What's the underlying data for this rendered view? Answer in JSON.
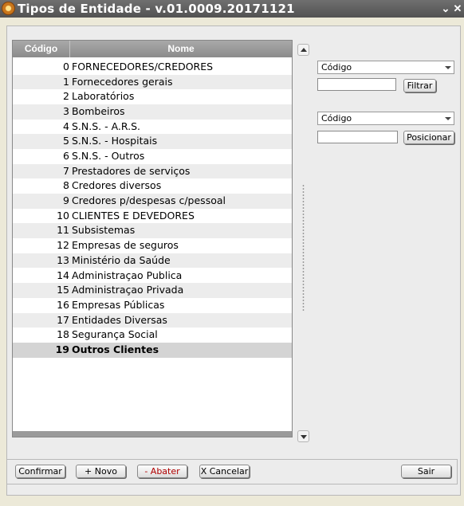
{
  "window": {
    "title": "Tipos de Entidade - v.01.0009.20171121",
    "minimize_glyph": "⌄",
    "close_glyph": "✕"
  },
  "grid": {
    "columns": {
      "code": "Código",
      "name": "Nome"
    },
    "rows": [
      {
        "code": "0",
        "name": "FORNECEDORES/CREDORES"
      },
      {
        "code": "1",
        "name": "Fornecedores gerais"
      },
      {
        "code": "2",
        "name": "Laboratórios"
      },
      {
        "code": "3",
        "name": "Bombeiros"
      },
      {
        "code": "4",
        "name": "S.N.S. - A.R.S."
      },
      {
        "code": "5",
        "name": "S.N.S. - Hospitais"
      },
      {
        "code": "6",
        "name": "S.N.S. - Outros"
      },
      {
        "code": "7",
        "name": "Prestadores de serviços"
      },
      {
        "code": "8",
        "name": "Credores diversos"
      },
      {
        "code": "9",
        "name": "Credores p/despesas c/pessoal"
      },
      {
        "code": "10",
        "name": "CLIENTES E DEVEDORES"
      },
      {
        "code": "11",
        "name": "Subsistemas"
      },
      {
        "code": "12",
        "name": "Empresas de seguros"
      },
      {
        "code": "13",
        "name": "Ministério da Saúde"
      },
      {
        "code": "14",
        "name": "Administraçao Publica"
      },
      {
        "code": "15",
        "name": "Administraçao Privada"
      },
      {
        "code": "16",
        "name": "Empresas Públicas"
      },
      {
        "code": "17",
        "name": "Entidades Diversas"
      },
      {
        "code": "18",
        "name": "Segurança Social"
      },
      {
        "code": "19",
        "name": "Outros Clientes"
      }
    ],
    "selected_index": 19
  },
  "filter": {
    "field_select": "Código",
    "value": "",
    "button": "Filtrar"
  },
  "position": {
    "field_select": "Código",
    "value": "",
    "button": "Posicionar"
  },
  "footer": {
    "confirm": "Confirmar",
    "new": "+ Novo",
    "delete": "- Abater",
    "cancel": "X Cancelar",
    "exit": "Sair"
  }
}
